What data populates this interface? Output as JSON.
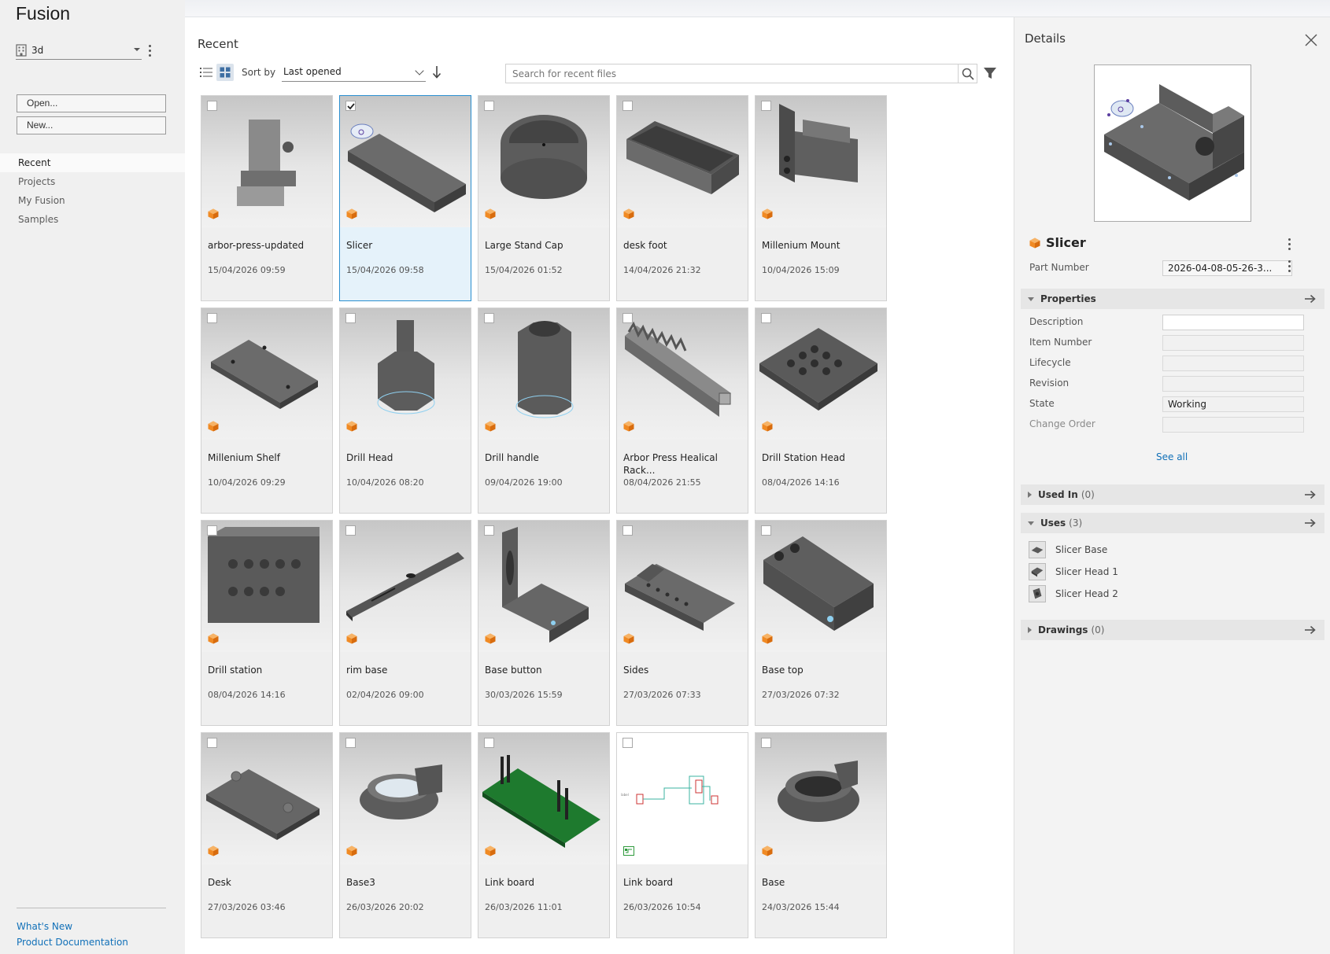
{
  "app": {
    "brand": "Fusion"
  },
  "sidebar": {
    "team": "3d",
    "open_label": "Open...",
    "new_label": "New...",
    "nav": [
      "Recent",
      "Projects",
      "My Fusion",
      "Samples"
    ],
    "links": [
      "What's New",
      "Product Documentation"
    ]
  },
  "main": {
    "title": "Recent",
    "sort_label": "Sort by",
    "sort_value": "Last opened",
    "search_placeholder": "Search for recent files"
  },
  "files": [
    {
      "name": "arbor-press-updated",
      "date": "15/04/2026 09:59",
      "selected": false,
      "type": "design"
    },
    {
      "name": "Slicer",
      "date": "15/04/2026 09:58",
      "selected": true,
      "type": "design"
    },
    {
      "name": "Large Stand Cap",
      "date": "15/04/2026 01:52",
      "selected": false,
      "type": "design"
    },
    {
      "name": "desk foot",
      "date": "14/04/2026 21:32",
      "selected": false,
      "type": "design"
    },
    {
      "name": "Millenium Mount",
      "date": "10/04/2026 15:09",
      "selected": false,
      "type": "design"
    },
    {
      "name": "Millenium Shelf",
      "date": "10/04/2026 09:29",
      "selected": false,
      "type": "design"
    },
    {
      "name": "Drill Head",
      "date": "10/04/2026 08:20",
      "selected": false,
      "type": "design"
    },
    {
      "name": "Drill handle",
      "date": "09/04/2026 19:00",
      "selected": false,
      "type": "design"
    },
    {
      "name": "Arbor Press Healical Rack...",
      "date": "08/04/2026 21:55",
      "selected": false,
      "type": "design"
    },
    {
      "name": "Drill Station Head",
      "date": "08/04/2026 14:16",
      "selected": false,
      "type": "design"
    },
    {
      "name": "Drill station",
      "date": "08/04/2026 14:16",
      "selected": false,
      "type": "design"
    },
    {
      "name": "rim base",
      "date": "02/04/2026 09:00",
      "selected": false,
      "type": "design"
    },
    {
      "name": "Base button",
      "date": "30/03/2026 15:59",
      "selected": false,
      "type": "design"
    },
    {
      "name": "Sides",
      "date": "27/03/2026 07:33",
      "selected": false,
      "type": "design"
    },
    {
      "name": "Base top",
      "date": "27/03/2026 07:32",
      "selected": false,
      "type": "design"
    },
    {
      "name": "Desk",
      "date": "27/03/2026 03:46",
      "selected": false,
      "type": "design"
    },
    {
      "name": "Base3",
      "date": "26/03/2026 20:02",
      "selected": false,
      "type": "design"
    },
    {
      "name": "Link board",
      "date": "26/03/2026 11:01",
      "selected": false,
      "type": "pcb"
    },
    {
      "name": "Link board",
      "date": "26/03/2026 10:54",
      "selected": false,
      "type": "schematic"
    },
    {
      "name": "Base",
      "date": "24/03/2026 15:44",
      "selected": false,
      "type": "design"
    }
  ],
  "details": {
    "title": "Details",
    "name": "Slicer",
    "part_number_label": "Part Number",
    "part_number": "2026-04-08-05-26-3...",
    "properties_title": "Properties",
    "properties": [
      {
        "label": "Description",
        "value": ""
      },
      {
        "label": "Item Number",
        "value": ""
      },
      {
        "label": "Lifecycle",
        "value": ""
      },
      {
        "label": "Revision",
        "value": ""
      },
      {
        "label": "State",
        "value": "Working"
      },
      {
        "label": "Change Order",
        "value": ""
      }
    ],
    "see_all": "See all",
    "used_in_title": "Used In",
    "used_in_count": "(0)",
    "uses_title": "Uses",
    "uses_count": "(3)",
    "uses": [
      "Slicer Base",
      "Slicer Head 1",
      "Slicer Head 2"
    ],
    "drawings_title": "Drawings",
    "drawings_count": "(0)"
  },
  "colors": {
    "accent": "#1170b8",
    "selected_border": "#2a8fd0",
    "selected_bg": "#e5f2fa",
    "design_icon": "#f08a24"
  },
  "icons": [
    "building-icon",
    "kebab-icon",
    "list-view-icon",
    "grid-view-icon",
    "sort-direction-icon",
    "search-icon",
    "filter-icon",
    "close-icon",
    "arrow-right-icon",
    "design-cube-icon",
    "schematic-icon"
  ]
}
